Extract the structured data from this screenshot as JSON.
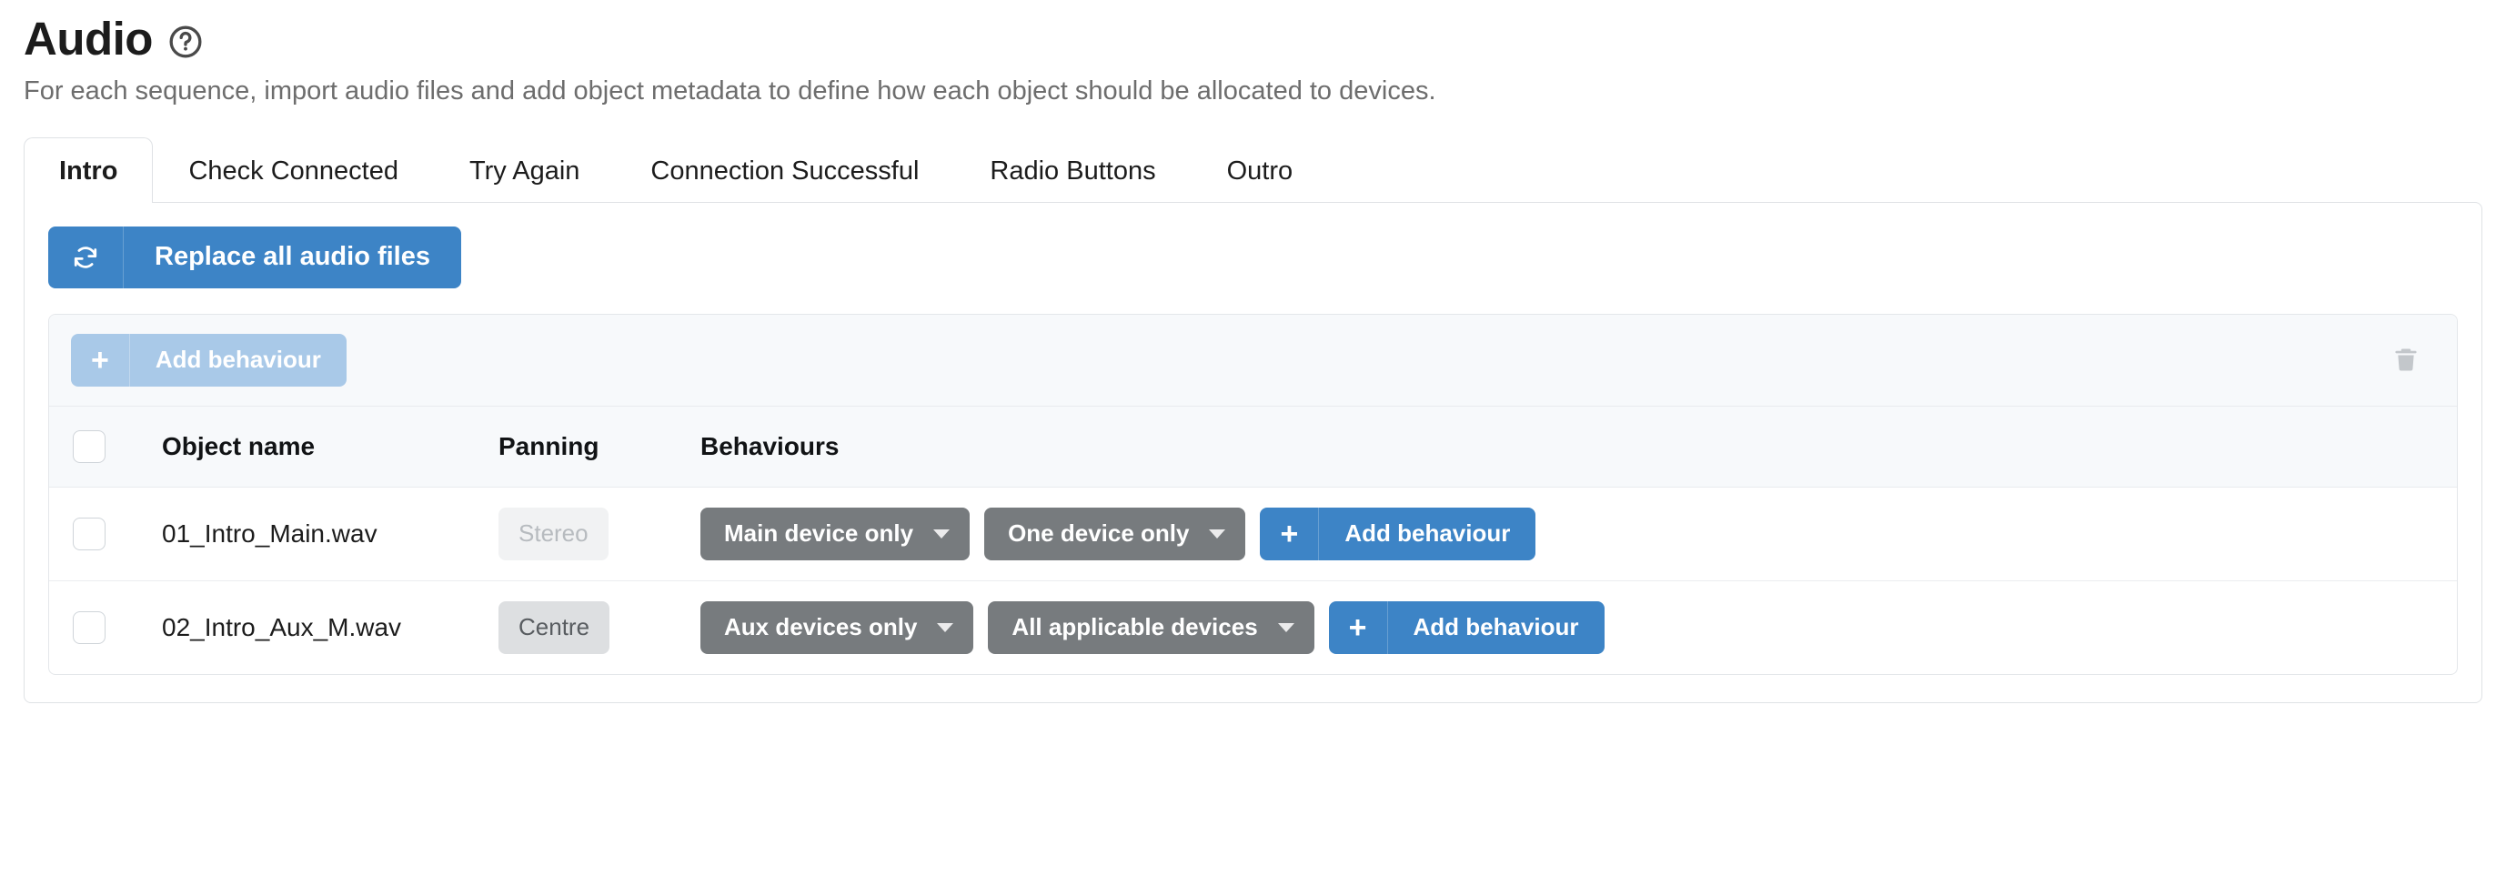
{
  "header": {
    "title": "Audio",
    "help_icon": "question-circle-icon",
    "description": "For each sequence, import audio files and add object metadata to define how each object should be allocated to devices."
  },
  "tabs": [
    {
      "label": "Intro",
      "active": true
    },
    {
      "label": "Check Connected",
      "active": false
    },
    {
      "label": "Try Again",
      "active": false
    },
    {
      "label": "Connection Successful",
      "active": false
    },
    {
      "label": "Radio Buttons",
      "active": false
    },
    {
      "label": "Outro",
      "active": false
    }
  ],
  "toolbar": {
    "replace_all_label": "Replace all audio files",
    "replace_all_icon": "refresh-icon"
  },
  "card": {
    "add_behaviour_label": "Add behaviour",
    "add_behaviour_icon": "plus-icon",
    "add_behaviour_disabled": true,
    "delete_icon": "trash-icon"
  },
  "table": {
    "columns": [
      "Object name",
      "Panning",
      "Behaviours"
    ],
    "rows": [
      {
        "checked": false,
        "object_name": "01_Intro_Main.wav",
        "panning": "Stereo",
        "panning_style": "muted",
        "behaviours": [
          "Main device only",
          "One device only"
        ],
        "add_behaviour_label": "Add behaviour"
      },
      {
        "checked": false,
        "object_name": "02_Intro_Aux_M.wav",
        "panning": "Centre",
        "panning_style": "solid",
        "behaviours": [
          "Aux devices only",
          "All applicable devices"
        ],
        "add_behaviour_label": "Add behaviour"
      }
    ]
  },
  "colors": {
    "accent_blue": "#3d84c6",
    "accent_blue_disabled": "#a9c9e8",
    "dropdown_gray": "#777b7e",
    "panel_border": "#dfe2e5",
    "header_band": "#f7f9fb",
    "pill_muted_bg": "#f1f2f3",
    "pill_solid_bg": "#dddfe1"
  }
}
